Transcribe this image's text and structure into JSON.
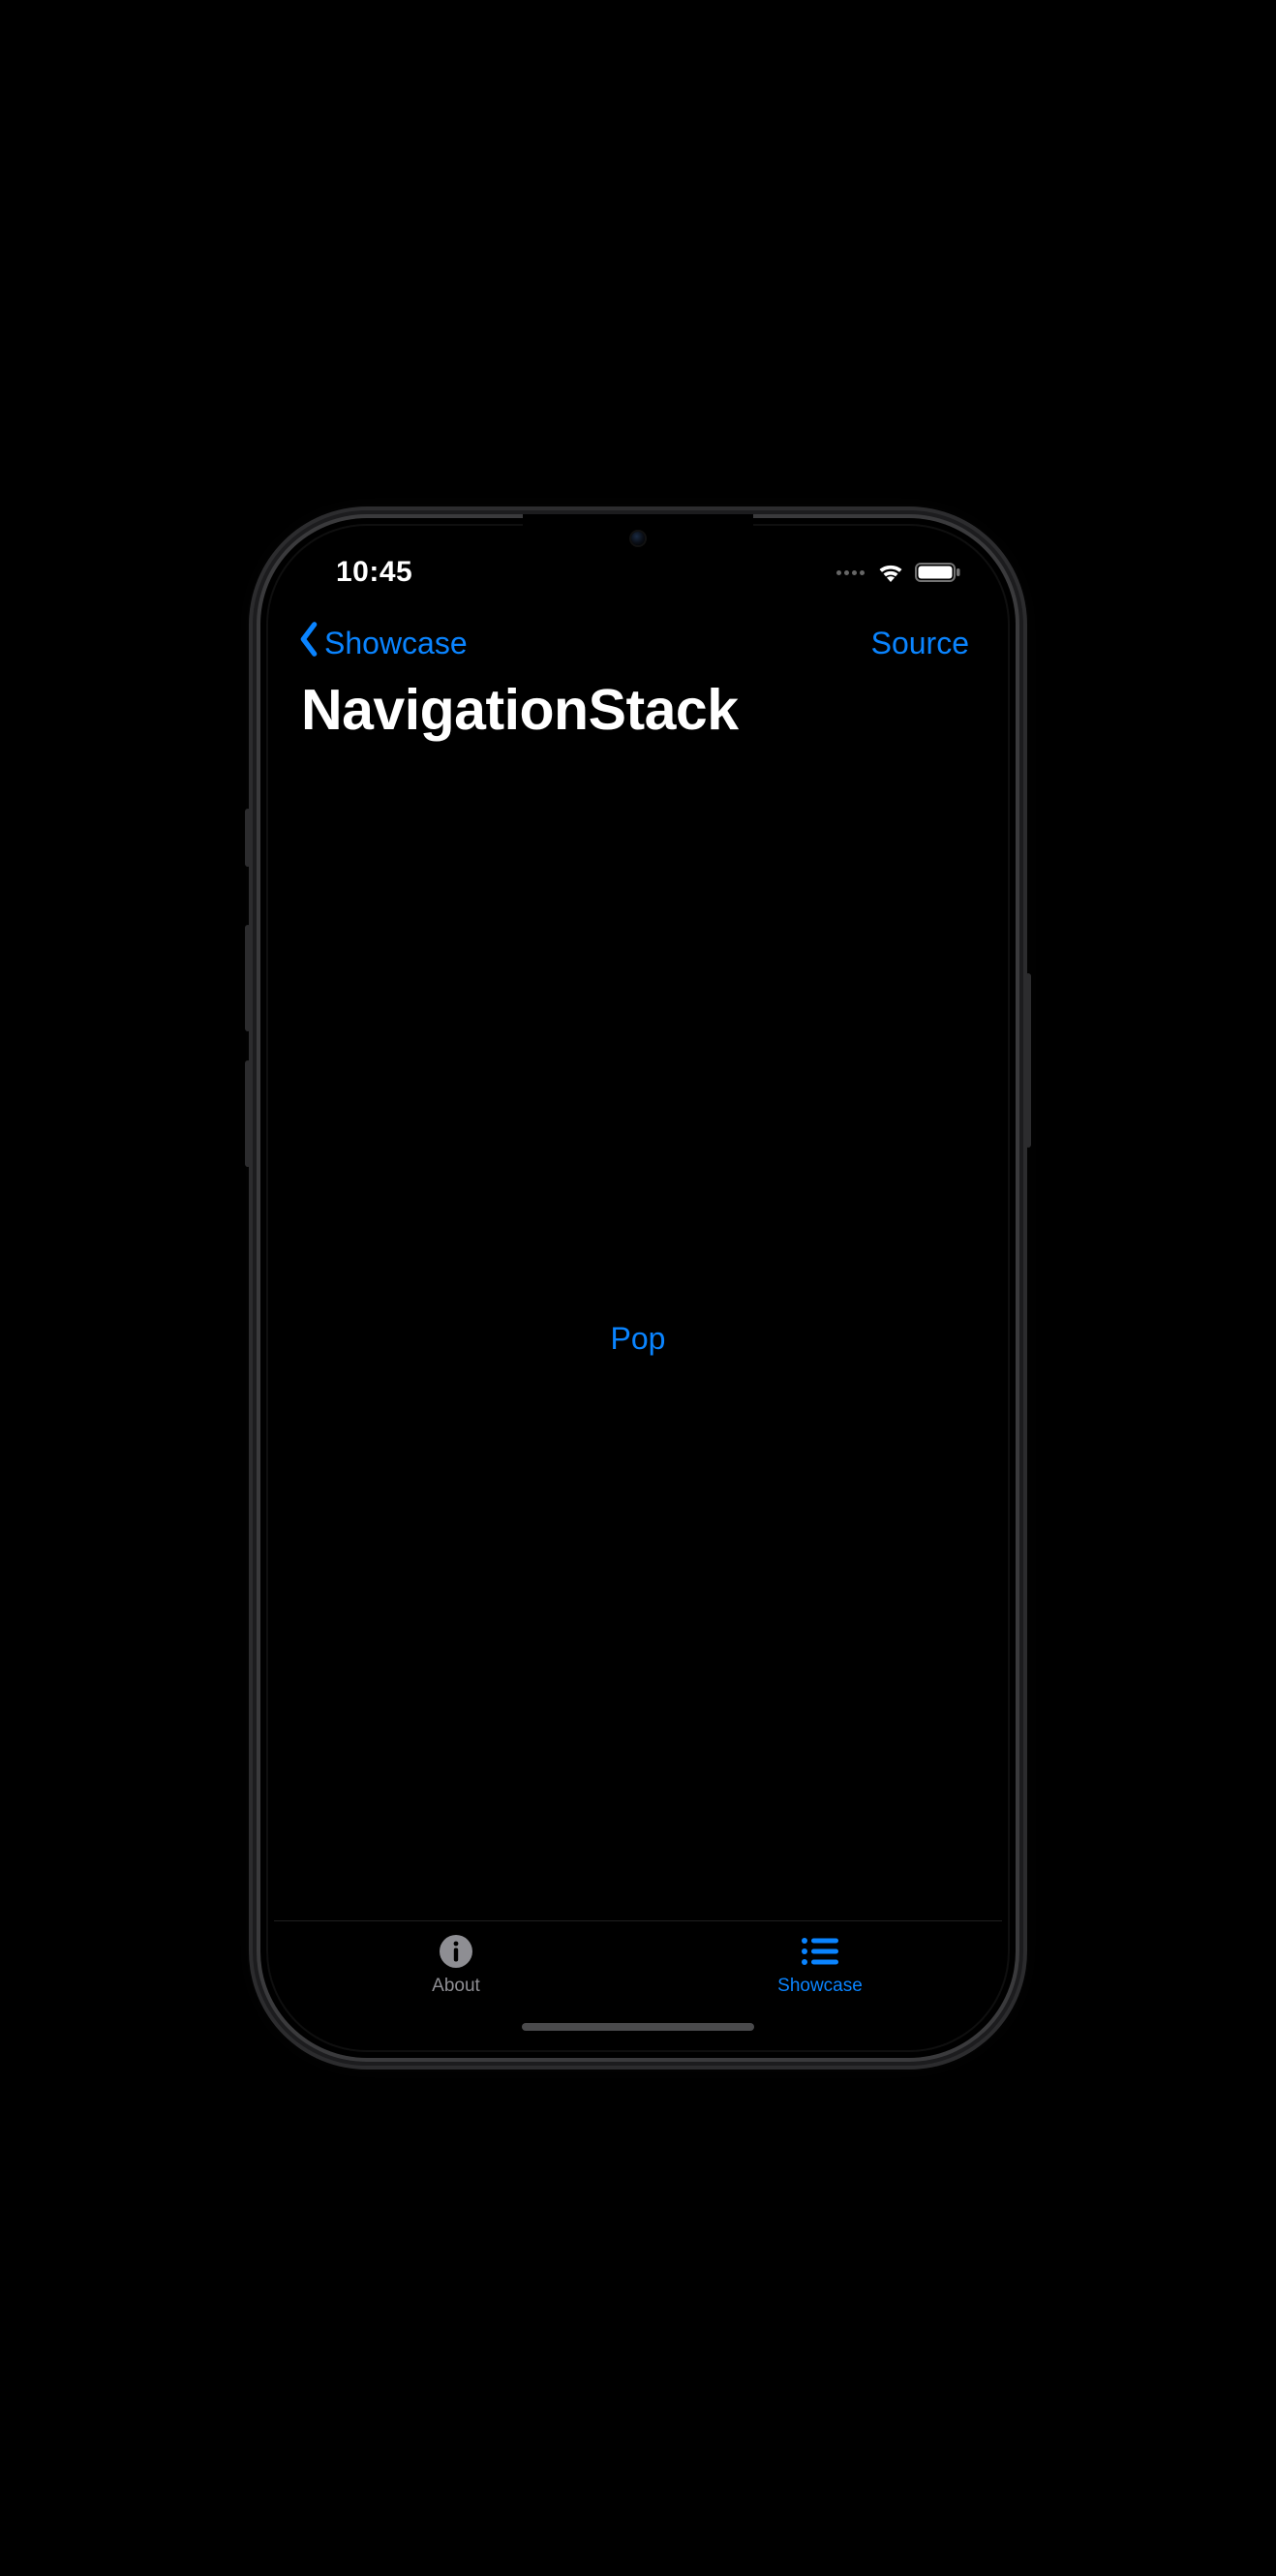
{
  "status": {
    "time": "10:45"
  },
  "nav": {
    "back_label": "Showcase",
    "source_label": "Source",
    "title": "NavigationStack"
  },
  "content": {
    "pop_label": "Pop"
  },
  "tabs": {
    "about": {
      "label": "About",
      "active": false
    },
    "showcase": {
      "label": "Showcase",
      "active": true
    }
  },
  "colors": {
    "accent": "#0a84ff",
    "inactive": "#8e8e93"
  }
}
